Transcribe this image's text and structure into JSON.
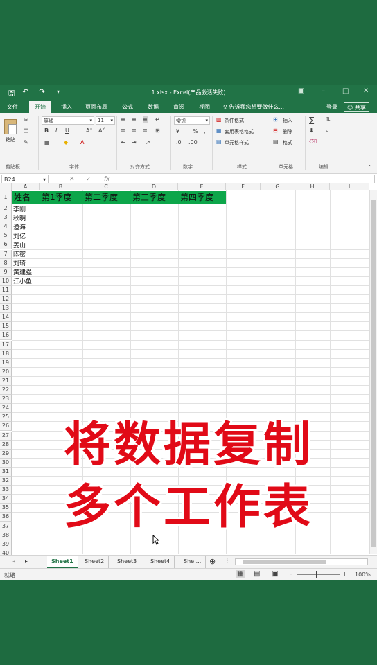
{
  "window": {
    "title": "1.xlsx - Excel(产品激活失败)"
  },
  "menu": {
    "tabs": [
      "文件",
      "开始",
      "插入",
      "页面布局",
      "公式",
      "数据",
      "审阅",
      "视图"
    ],
    "active_tab": "开始",
    "tell_me": "告诉我您想要做什么...",
    "login": "登录",
    "share": "共享"
  },
  "ribbon": {
    "paste": "粘贴",
    "clipboard": "剪贴板",
    "font_name": "等线",
    "font_size": "11",
    "font_group": "字体",
    "align_group": "对齐方式",
    "number_format": "常规",
    "number_group": "数字",
    "cond_format": "条件格式",
    "table_format": "套用表格格式",
    "cell_style": "单元格样式",
    "style_group": "样式",
    "insert": "插入",
    "delete": "删除",
    "format": "格式",
    "cells_group": "单元格",
    "edit_group": "编辑"
  },
  "formula_bar": {
    "name_box": "B24",
    "fx": "fx",
    "content": ""
  },
  "grid": {
    "columns": [
      "A",
      "B",
      "C",
      "D",
      "E",
      "F",
      "G",
      "H",
      "I"
    ],
    "header_row": [
      "姓名",
      "第1季度",
      "第二季度",
      "第三季度",
      "第四季度"
    ],
    "names": [
      "李刚",
      "秋明",
      "澄海",
      "刘亿",
      "姜山",
      "陈密",
      "刘琦",
      "黄建强",
      "江小鱼"
    ],
    "row_count": 40
  },
  "overlay": {
    "line1": "将数据复制",
    "line2": "多个工作表"
  },
  "sheets": {
    "tabs": [
      "Sheet1",
      "Sheet2",
      "Sheet3",
      "Sheet4",
      "She ..."
    ],
    "active": "Sheet1"
  },
  "status": {
    "ready": "就绪",
    "zoom": "100%"
  },
  "colors": {
    "excel_green": "#217346",
    "header_fill": "#0da64a",
    "overlay_red": "#e10a17"
  }
}
